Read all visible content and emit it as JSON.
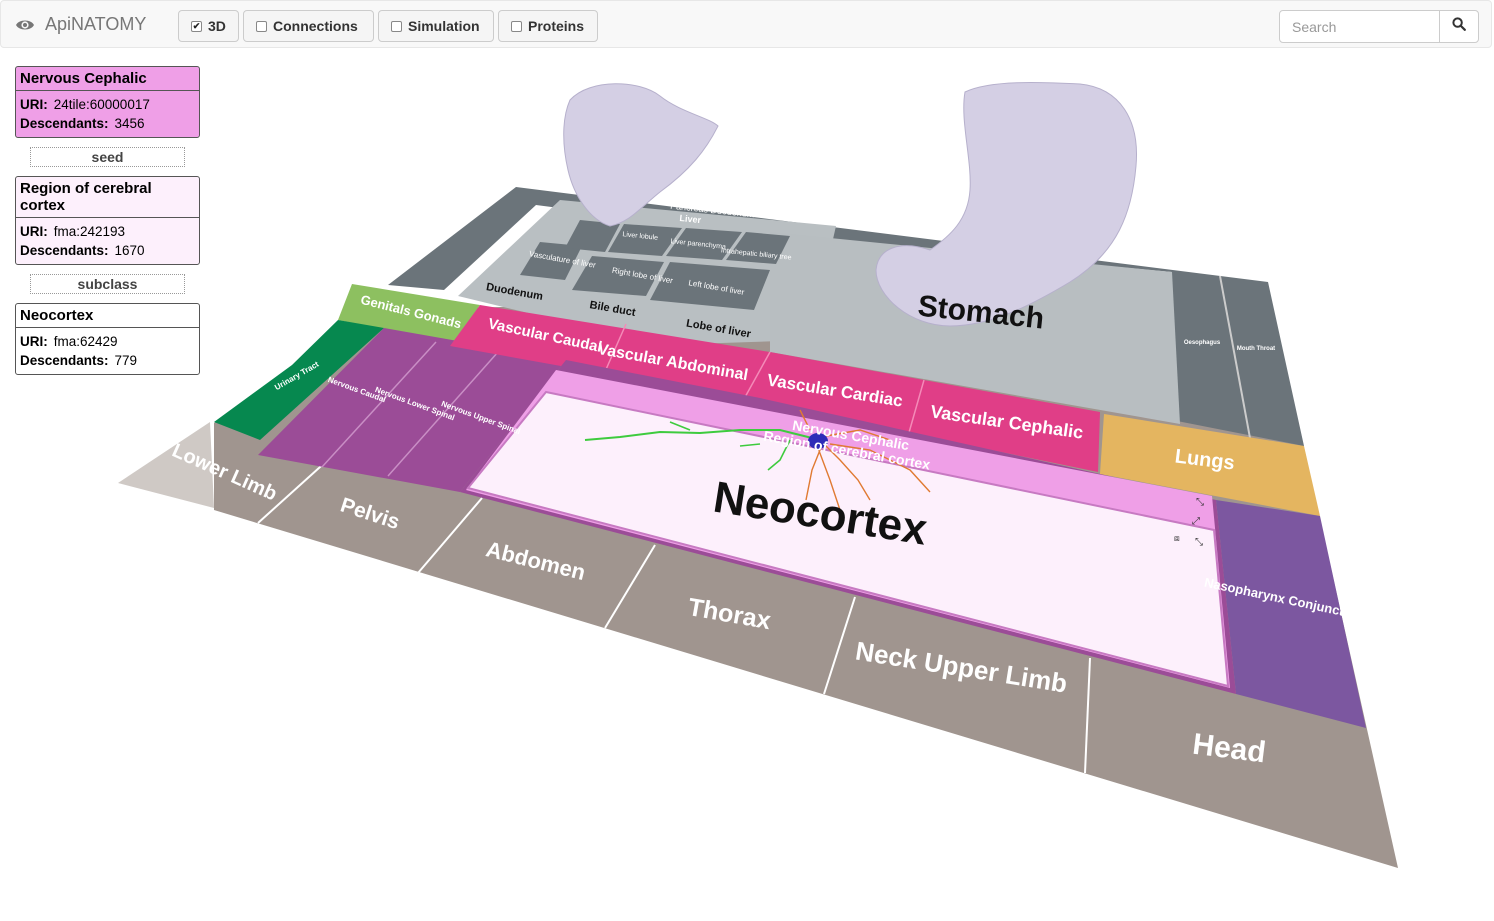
{
  "app": {
    "name": "ApiNATOMY"
  },
  "toolbar": {
    "buttons": [
      {
        "label": "3D",
        "checked": true
      },
      {
        "label": "Connections",
        "checked": false
      },
      {
        "label": "Simulation",
        "checked": false
      },
      {
        "label": "Proteins",
        "checked": false
      }
    ]
  },
  "search": {
    "placeholder": "Search",
    "value": ""
  },
  "panels": [
    {
      "title": "Nervous Cephalic",
      "uri_label": "URI:",
      "uri": "24tile:60000017",
      "desc_label": "Descendants:",
      "descendants": "3456",
      "color": "#ef9fe7"
    },
    {
      "relation": "seed"
    },
    {
      "title": "Region of cerebral cortex",
      "uri_label": "URI:",
      "uri": "fma:242193",
      "desc_label": "Descendants:",
      "descendants": "1670",
      "color": "#fdf0fc"
    },
    {
      "relation": "subclass"
    },
    {
      "title": "Neocortex",
      "uri_label": "URI:",
      "uri": "fma:62429",
      "desc_label": "Descendants:",
      "descendants": "779",
      "color": "#ffffff"
    }
  ],
  "scene": {
    "body_tiles": [
      "Lower Limb",
      "Pelvis",
      "Abdomen",
      "Thorax",
      "Neck Upper Limb",
      "Head"
    ],
    "vascular_tiles": [
      "Vascular Caudal",
      "Vascular Abdominal",
      "Vascular Cardiac",
      "Vascular Cephalic"
    ],
    "other_tiles": {
      "genitals": "Genitals Gonads",
      "lungs": "Lungs",
      "nasopharynx": "Nasopharynx Conjunctiva",
      "urinary": "Urinary Tract",
      "stomach": "Stomach",
      "nervous_cephalic": "Nervous Cephalic",
      "region_cortex": "Region of cerebral cortex",
      "neocortex": "Neocortex"
    },
    "nervous_tiles": [
      "Nervous Caudal",
      "Nervous Lower Spinal",
      "Nervous Upper Spinal"
    ],
    "liver_tiles": [
      "Duodenum",
      "Bile duct",
      "Lobe of liver",
      "Vasculature of liver",
      "Right lobe of liver",
      "Left lobe of liver",
      "Liver",
      "Pancreas Duodenum",
      "Intrahepatic biliary tree",
      "Liver parenchyma",
      "Liver lobule"
    ],
    "right_tiles": [
      "Oesophagus",
      "Mouth Throat"
    ],
    "colors": {
      "body": "#a0958f",
      "nervous": "#9b4c97",
      "vascular": "#e03e87",
      "lungs": "#e4b560",
      "nasopharynx": "#7c57a0",
      "genitals": "#8dc060",
      "urinary": "#06884f",
      "gut": "#6b747a",
      "stomach": "#b8bec1",
      "neocortex": "#fdf0fc",
      "organ": "#d4cfe4"
    }
  }
}
